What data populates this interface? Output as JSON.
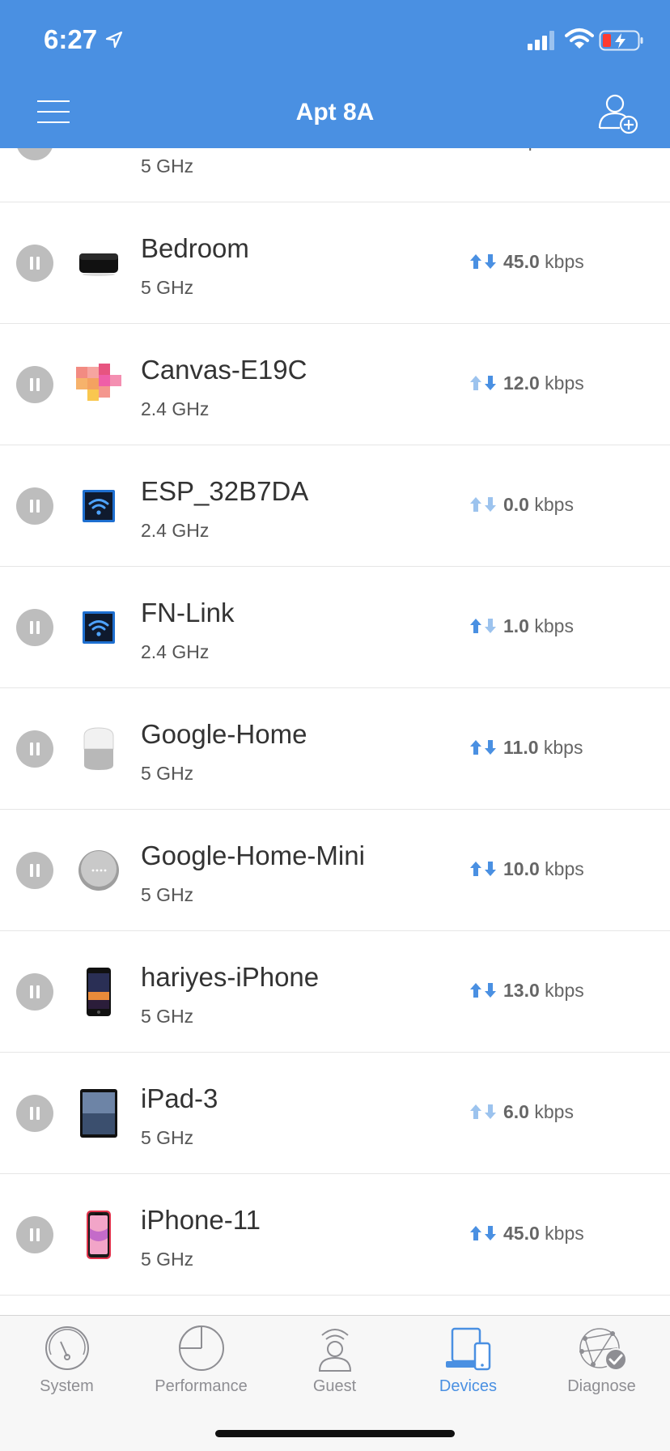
{
  "status_bar": {
    "time": "6:27"
  },
  "header": {
    "title": "Apt 8A"
  },
  "devices": [
    {
      "name": "",
      "band": "5 GHz",
      "rate_value": "",
      "rate_unit": "kbps",
      "icon": "phone-icon"
    },
    {
      "name": "Bedroom",
      "band": "5 GHz",
      "rate_value": "45.0",
      "rate_unit": "kbps",
      "icon": "apple-tv-icon"
    },
    {
      "name": "Canvas-E19C",
      "band": "2.4 GHz",
      "rate_value": "12.0",
      "rate_unit": "kbps",
      "icon": "canvas-icon"
    },
    {
      "name": "ESP_32B7DA",
      "band": "2.4 GHz",
      "rate_value": "0.0",
      "rate_unit": "kbps",
      "icon": "wifi-device-icon"
    },
    {
      "name": "FN-Link",
      "band": "2.4 GHz",
      "rate_value": "1.0",
      "rate_unit": "kbps",
      "icon": "wifi-device-icon"
    },
    {
      "name": "Google-Home",
      "band": "5 GHz",
      "rate_value": "11.0",
      "rate_unit": "kbps",
      "icon": "google-home-icon"
    },
    {
      "name": "Google-Home-Mini",
      "band": "5 GHz",
      "rate_value": "10.0",
      "rate_unit": "kbps",
      "icon": "google-home-mini-icon"
    },
    {
      "name": "hariyes-iPhone",
      "band": "5 GHz",
      "rate_value": "13.0",
      "rate_unit": "kbps",
      "icon": "iphone-icon"
    },
    {
      "name": "iPad-3",
      "band": "5 GHz",
      "rate_value": "6.0",
      "rate_unit": "kbps",
      "icon": "ipad-icon"
    },
    {
      "name": "iPhone-11",
      "band": "5 GHz",
      "rate_value": "45.0",
      "rate_unit": "kbps",
      "icon": "iphone-11-icon"
    }
  ],
  "tabs": [
    {
      "label": "System",
      "icon": "gauge-icon"
    },
    {
      "label": "Performance",
      "icon": "pie-chart-icon"
    },
    {
      "label": "Guest",
      "icon": "guest-icon"
    },
    {
      "label": "Devices",
      "icon": "devices-icon",
      "active": true
    },
    {
      "label": "Diagnose",
      "icon": "diagnose-icon"
    }
  ],
  "colors": {
    "accent": "#4a90e2",
    "arrow_light": "#9cc3ee",
    "pause_gray": "#bdbdbd"
  }
}
